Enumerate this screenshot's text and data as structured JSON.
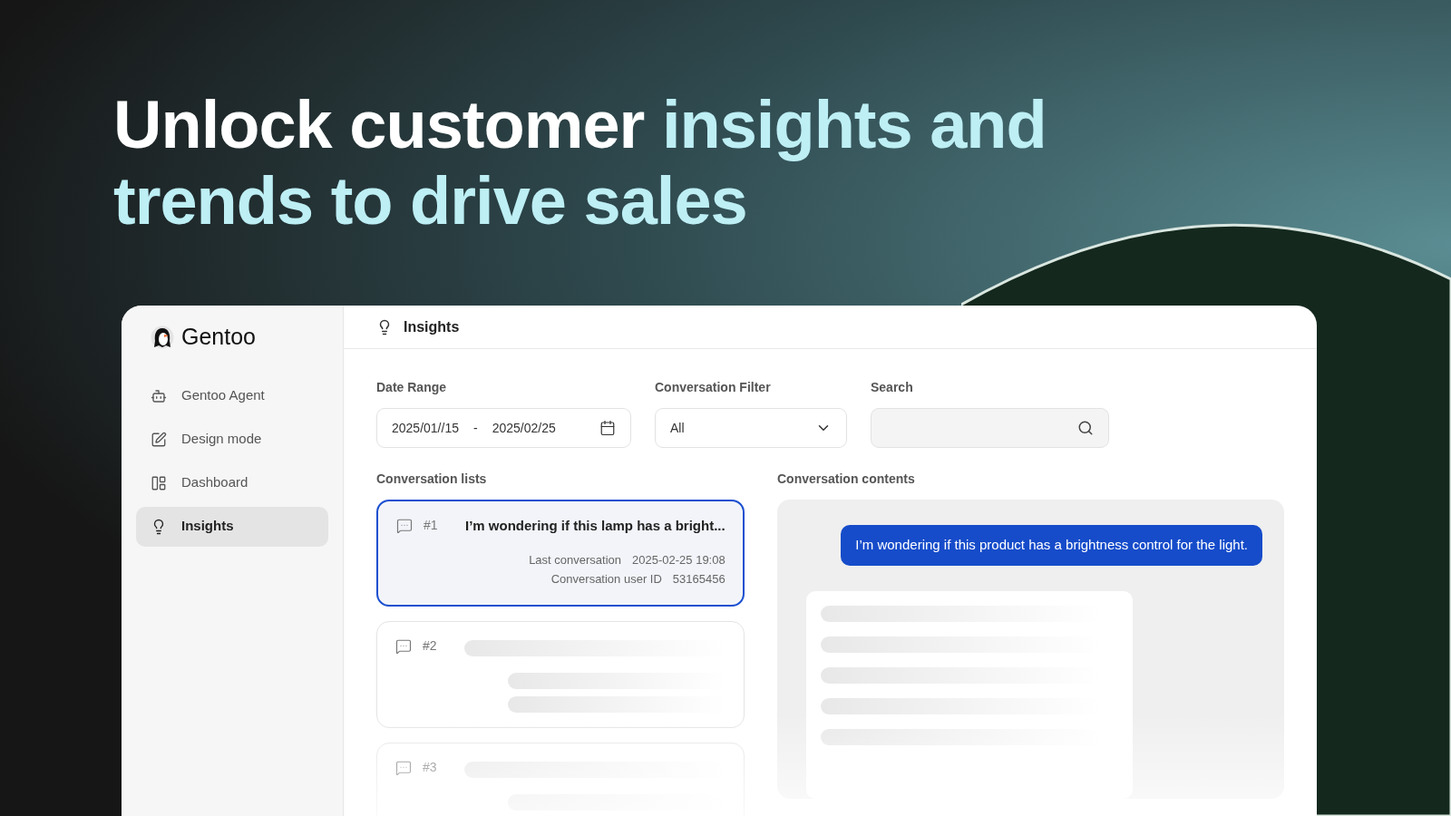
{
  "headline": [
    {
      "text": "Unlock customer ",
      "highlighted": false
    },
    {
      "text": "insights and trends to drive sales",
      "highlighted": true
    }
  ],
  "app": {
    "brand": "Gentoo",
    "sidebar": {
      "items": [
        {
          "label": "Gentoo Agent",
          "selected": false
        },
        {
          "label": "Design mode",
          "selected": false
        },
        {
          "label": "Dashboard",
          "selected": false
        },
        {
          "label": "Insights",
          "selected": true
        }
      ]
    },
    "header": {
      "title": "Insights"
    },
    "filters": {
      "date_range": {
        "label": "Date Range",
        "start": "2025/01//15",
        "separator": "-",
        "end": "2025/02/25"
      },
      "conversation_filter": {
        "label": "Conversation Filter",
        "value": "All"
      },
      "search": {
        "label": "Search"
      }
    },
    "conversation_lists": {
      "title": "Conversation lists",
      "items": [
        {
          "number": "#1",
          "loaded": true,
          "selected": true,
          "preview": "I’m wondering if this lamp has a bright...",
          "details": [
            {
              "label": "Last conversation",
              "value": "2025-02-25 19:08"
            },
            {
              "label": "Conversation user ID",
              "value": "53165456"
            }
          ]
        },
        {
          "number": "#2",
          "loaded": false,
          "selected": false
        },
        {
          "number": "#3",
          "loaded": false,
          "selected": false
        }
      ]
    },
    "conversation_contents": {
      "title": "Conversation contents",
      "messages": [
        {
          "kind": "user",
          "text": "I’m wondering if this product has a brightness control for the light."
        },
        {
          "kind": "loading"
        }
      ]
    }
  }
}
